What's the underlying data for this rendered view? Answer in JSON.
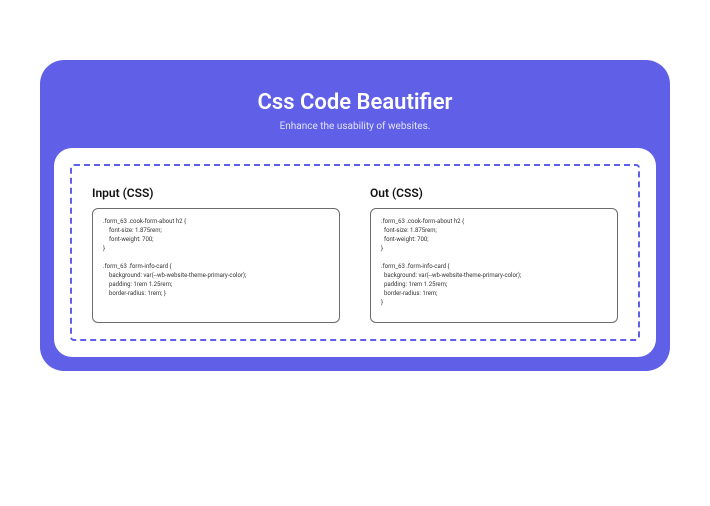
{
  "header": {
    "title": "Css Code Beautifier",
    "subtitle": "Enhance the usability of websites."
  },
  "input": {
    "label": "Input (CSS)",
    "code": ".form_63 .cook-form-about h2 {\n    font-size: 1.875rem;\n    font-weight: 700;\n}\n\n.form_63 .form-info-card {\n    background: var(--wb-website-theme-primary-color);\n    padding: 1rem 1.25rem;\n    border-radius: 1rem; }"
  },
  "output": {
    "label": "Out (CSS)",
    "code": ".form_63 .cook-form-about h2 {\n  font-size: 1.875rem;\n  font-weight: 700;\n}\n\n.form_63 .form-info-card {\n  background: var(--wb-website-theme-primary-color);\n  padding: 1rem 1.25rem;\n  border-radius: 1rem;\n}"
  }
}
